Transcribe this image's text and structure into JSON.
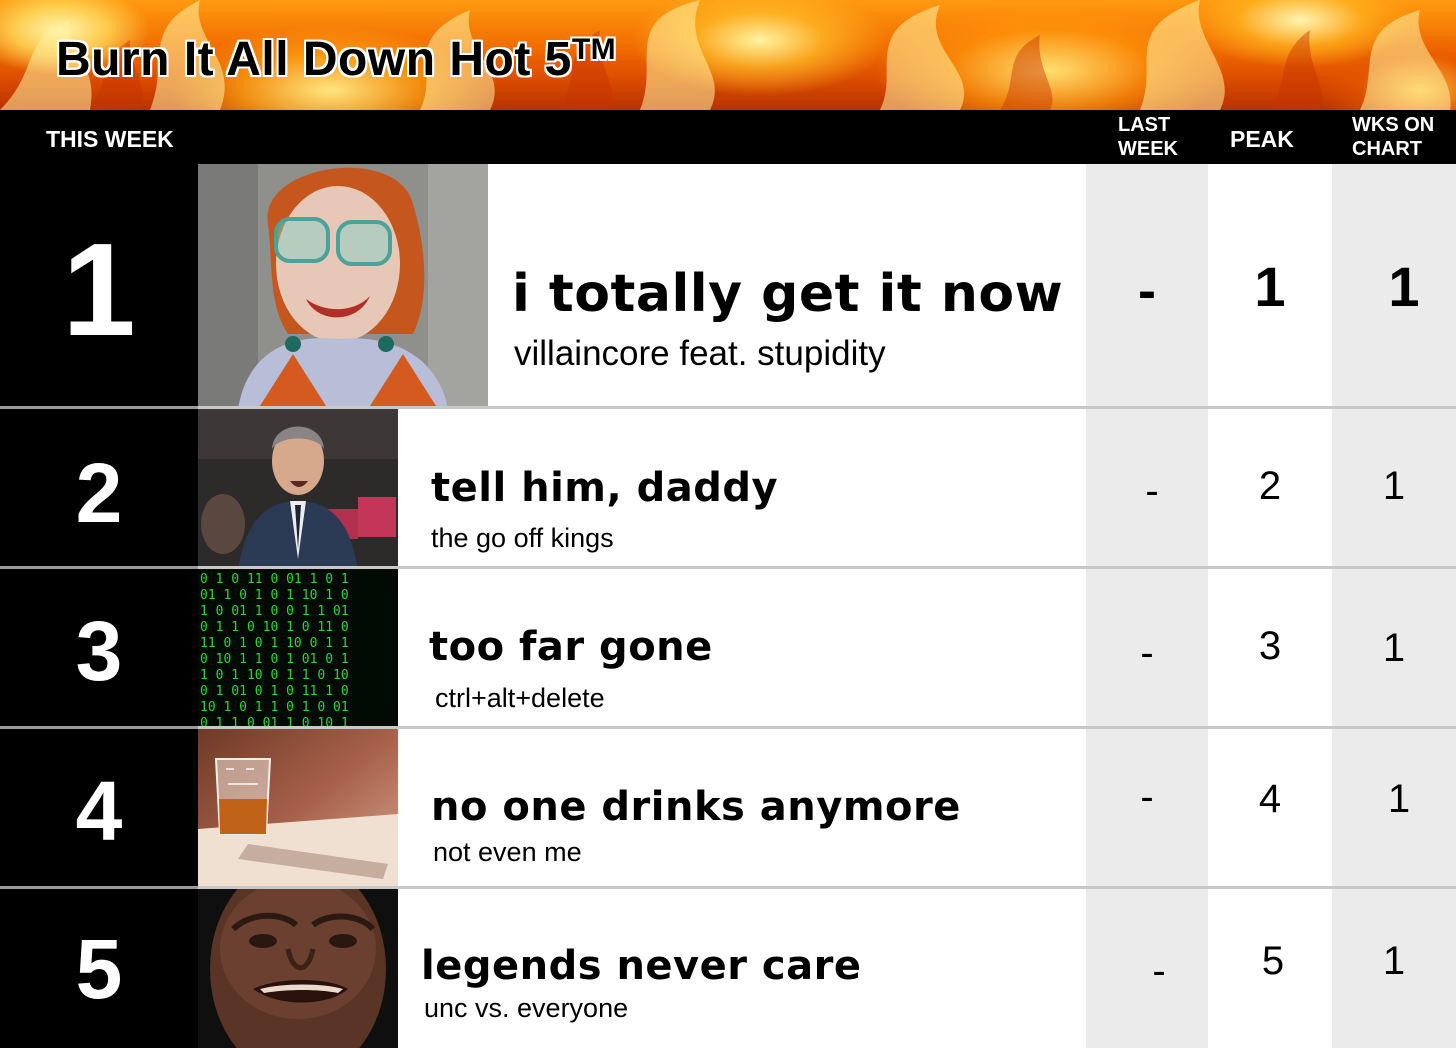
{
  "chart": {
    "title": "Burn It All Down Hot 5",
    "title_mark": "TM"
  },
  "header": {
    "this_week": "THIS WEEK",
    "last_week_line1": "LAST",
    "last_week_line2": "WEEK",
    "peak": "PEAK",
    "wks_line1": "WKS ON",
    "wks_line2": "CHART"
  },
  "entries": [
    {
      "rank": "1",
      "title": "i totally get it now",
      "artist": "villaincore feat. stupidity",
      "last_week": "-",
      "peak": "1",
      "weeks_on_chart": "1",
      "thumbnail": "woman-glasses-photo"
    },
    {
      "rank": "2",
      "title": "tell him, daddy",
      "artist": "the go off kings",
      "last_week": "-",
      "peak": "2",
      "weeks_on_chart": "1",
      "thumbnail": "speaker-podium-photo"
    },
    {
      "rank": "3",
      "title": "too far gone",
      "artist": "ctrl+alt+delete",
      "last_week": "-",
      "peak": "3",
      "weeks_on_chart": "1",
      "thumbnail": "binary-code-photo"
    },
    {
      "rank": "4",
      "title": "no one drinks anymore",
      "artist": "not even me",
      "last_week": "-",
      "peak": "4",
      "weeks_on_chart": "1",
      "thumbnail": "whiskey-glass-photo"
    },
    {
      "rank": "5",
      "title": "legends never care",
      "artist": "unc vs. everyone",
      "last_week": "-",
      "peak": "5",
      "weeks_on_chart": "1",
      "thumbnail": "man-portrait-photo"
    }
  ],
  "colors": {
    "flame_orange": "#f06a00",
    "flame_yellow": "#ffe680",
    "stat_gray": "#ebebeb",
    "rank_black": "#000000",
    "matrix_green": "#2bd63a"
  }
}
